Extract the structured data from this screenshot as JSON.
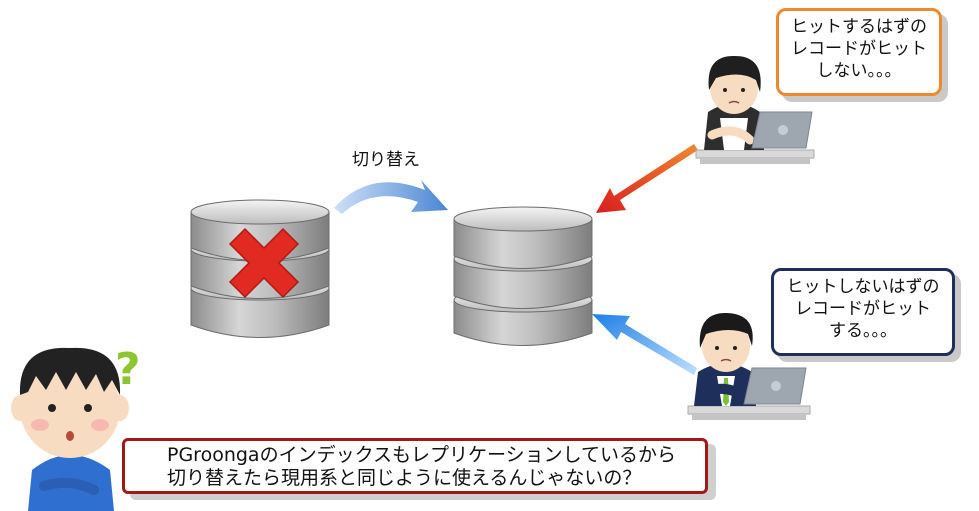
{
  "switch_label": "切り替え",
  "bubble_top": {
    "lines": [
      "ヒットするはずの",
      "レコードがヒット",
      "しない。。。"
    ]
  },
  "bubble_middle": {
    "lines": [
      "ヒットしないはずの",
      "レコードがヒット",
      "する。。。"
    ]
  },
  "bubble_bottom": {
    "lines": [
      "PGroongaのインデックスもレプリケーションしているから",
      "切り替えたら現用系と同じように使えるんじゃないの？"
    ]
  },
  "question_mark": "?",
  "colors": {
    "orange_border": "#ee8a2d",
    "navy_border": "#1f2f5c",
    "red_border": "#a01818",
    "red_arrow": "#e0301e",
    "blue_arrow": "#2a8de8",
    "switch_arrow": "#5b8fd6",
    "cross": "#e02a22",
    "db_gray": "#a9a9a9"
  }
}
